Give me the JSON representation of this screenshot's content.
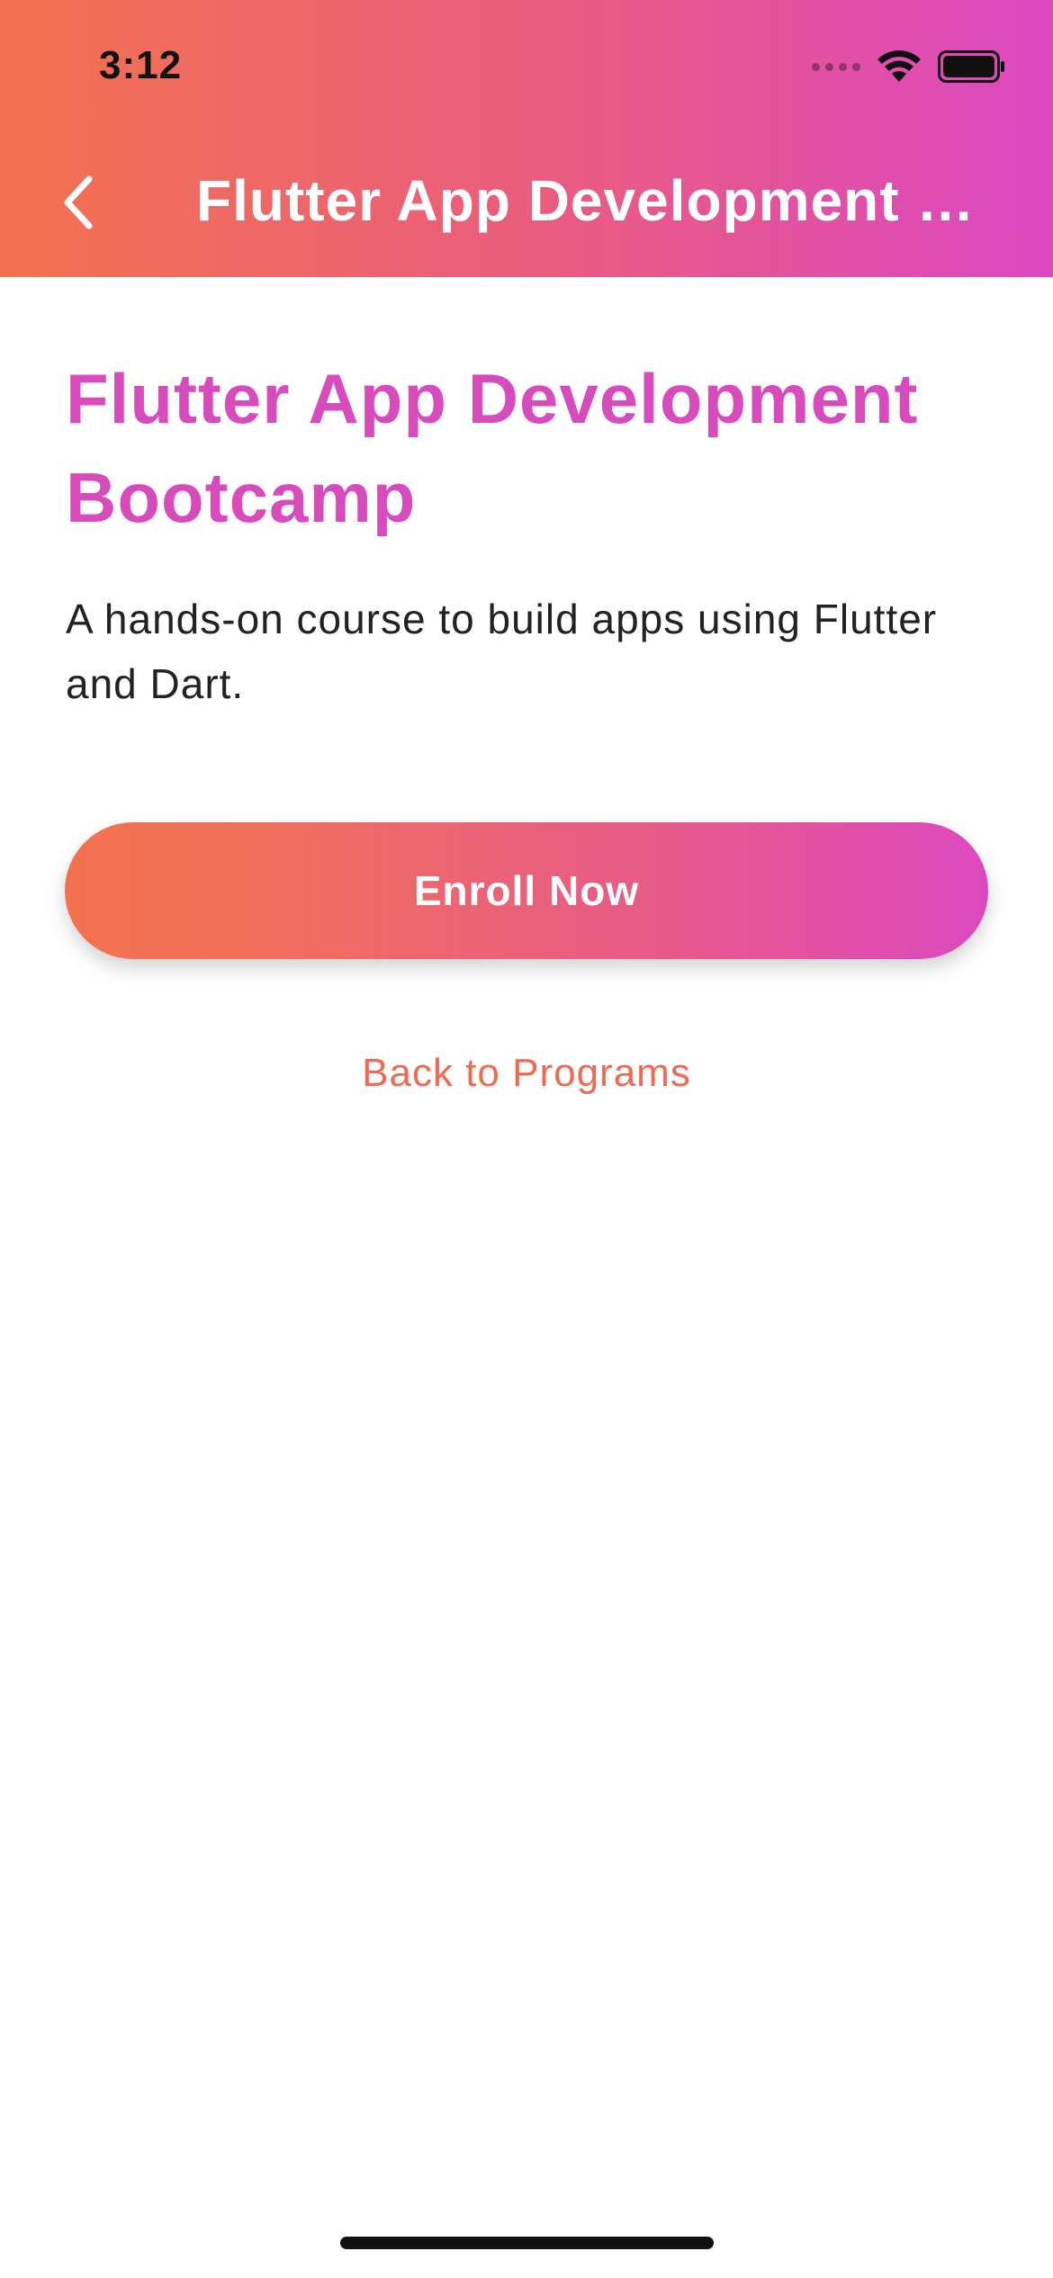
{
  "status_bar": {
    "time": "3:12"
  },
  "app_bar": {
    "title": "Flutter App Development Bootcamp",
    "back_icon": "chevron-left-icon"
  },
  "course": {
    "title": "Flutter App Development Bootcamp",
    "description": "A hands-on course to build apps using Flutter and Dart."
  },
  "actions": {
    "enroll_label": "Enroll Now",
    "back_link_label": "Back to Programs"
  },
  "colors": {
    "gradient_start": "#f2724f",
    "gradient_end": "#db48c2",
    "title_color": "#d84bbd",
    "link_color": "#ee6a52"
  }
}
